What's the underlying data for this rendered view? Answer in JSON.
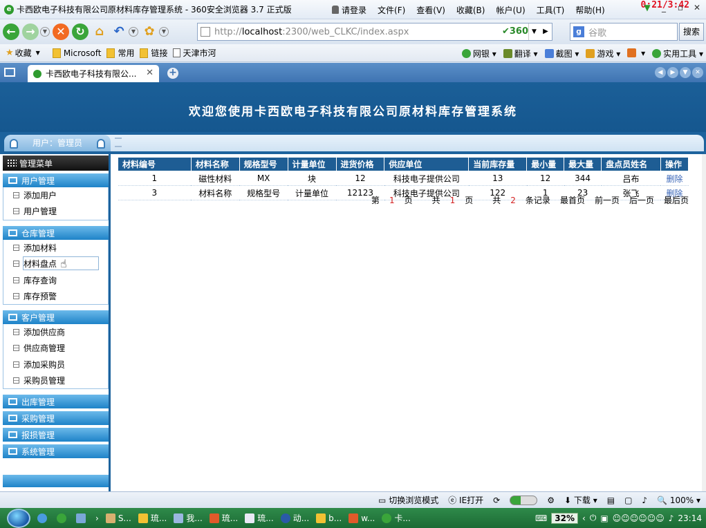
{
  "browser": {
    "window_title": "卡西欧电子科技有限公司原材料库存管理系统 - 360安全浏览器 3.7 正式版",
    "login": "请登录",
    "menus": [
      "文件(F)",
      "查看(V)",
      "收藏(B)",
      "帐户(U)",
      "工具(T)",
      "帮助(H)"
    ],
    "clock_overlay": "0:21/3:42",
    "url_prefix": "http://",
    "url_host": "localhost",
    "url_rest": ":2300/web_CLKC/index.aspx",
    "brand": "360",
    "search_placeholder": "谷歌",
    "search_button": "搜索",
    "favorites": {
      "collect": "收藏",
      "items": [
        "Microsoft",
        "常用",
        "链接",
        "天津市河"
      ]
    },
    "tools": [
      "网银",
      "翻译",
      "截图",
      "游戏",
      "实用工具"
    ],
    "tab_title": "卡西欧电子科技有限公...",
    "status": {
      "mode": "切换浏览模式",
      "ie_open": "IE打开",
      "download": "下载",
      "zoom": "100%"
    }
  },
  "app": {
    "banner_title": "欢迎您使用卡西欧电子科技有限公司原材料库存管理系统",
    "user_label": "用户：管理员",
    "menu_header": "管理菜单",
    "groups": [
      {
        "title": "用户管理",
        "items": [
          "添加用户",
          "用户管理"
        ]
      },
      {
        "title": "仓库管理",
        "items": [
          "添加材料",
          "材料盘点",
          "库存查询",
          "库存预警"
        ]
      },
      {
        "title": "客户管理",
        "items": [
          "添加供应商",
          "供应商管理",
          "添加采购员",
          "采购员管理"
        ]
      },
      {
        "title": "出库管理",
        "items": []
      },
      {
        "title": "采购管理",
        "items": []
      },
      {
        "title": "报损管理",
        "items": []
      },
      {
        "title": "系统管理",
        "items": []
      }
    ],
    "table": {
      "headers": [
        "材料编号",
        "材料名称",
        "规格型号",
        "计量单位",
        "进货价格",
        "供应单位",
        "当前库存量",
        "最小量",
        "最大量",
        "盘点员姓名",
        "操作"
      ],
      "rows": [
        [
          "1",
          "磁性材料",
          "MX",
          "块",
          "12",
          "科技电子提供公司",
          "13",
          "12",
          "344",
          "吕布",
          "删除"
        ],
        [
          "3",
          "材料名称",
          "规格型号",
          "计量单位",
          "12123",
          "科技电子提供公司",
          "122",
          "1",
          "23",
          "张飞",
          "删除"
        ]
      ]
    },
    "pager": {
      "page_prefix": "第",
      "page_num": "1",
      "page_suffix": "页",
      "total_prefix": "共",
      "total_pages": "1",
      "total_suffix": "页",
      "records_prefix": "共",
      "records": "2",
      "records_suffix": "条记录",
      "first": "最首页",
      "prev": "前一页",
      "next": "后一页",
      "last": "最后页"
    }
  },
  "taskbar": {
    "tasks": [
      "S...",
      "琉...",
      "我...",
      "琉...",
      "琉...",
      "动...",
      "b...",
      "w...",
      "卡..."
    ],
    "cpu": "32%",
    "time": "23:14"
  }
}
